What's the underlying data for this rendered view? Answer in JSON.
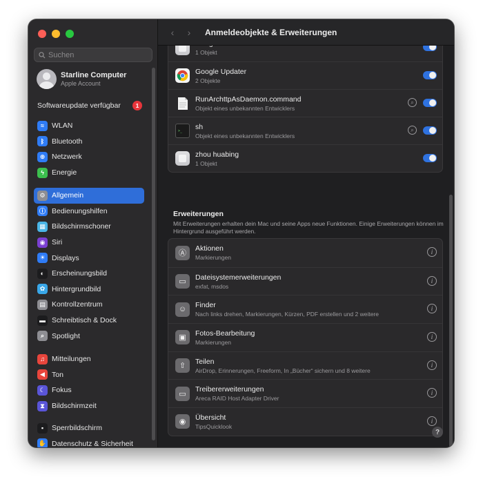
{
  "window": {
    "title": "Anmeldeobjekte & Erweiterungen",
    "back_icon": "‹",
    "forward_icon": "›"
  },
  "search": {
    "placeholder": "Suchen"
  },
  "account": {
    "name": "Starline Computer",
    "subtitle": "Apple Account"
  },
  "update": {
    "label": "Softwareupdate verfügbar",
    "count": "1"
  },
  "sidebar": {
    "group1": [
      {
        "label": "WLAN",
        "icon": "wifi-icon",
        "color": "#2f7cf6",
        "glyph": "≈"
      },
      {
        "label": "Bluetooth",
        "icon": "bluetooth-icon",
        "color": "#2f7cf6",
        "glyph": "ᛒ"
      },
      {
        "label": "Netzwerk",
        "icon": "globe-icon",
        "color": "#2f7cf6",
        "glyph": "⊕"
      },
      {
        "label": "Energie",
        "icon": "battery-icon",
        "color": "#3cbf4e",
        "glyph": "ϟ"
      }
    ],
    "group2": [
      {
        "label": "Allgemein",
        "icon": "gear-icon",
        "color": "#8e8e93",
        "glyph": "⚙",
        "selected": true
      },
      {
        "label": "Bedienungshilfen",
        "icon": "accessibility-icon",
        "color": "#2f7cf6",
        "glyph": "ⓘ"
      },
      {
        "label": "Bildschirmschoner",
        "icon": "screensaver-icon",
        "color": "#4ab5e6",
        "glyph": "▦"
      },
      {
        "label": "Siri",
        "icon": "siri-icon",
        "color": "#7a3fd1",
        "glyph": "◉"
      },
      {
        "label": "Displays",
        "icon": "display-icon",
        "color": "#2f7cf6",
        "glyph": "☀"
      },
      {
        "label": "Erscheinungsbild",
        "icon": "appearance-icon",
        "color": "#1c1c1e",
        "glyph": "◐"
      },
      {
        "label": "Hintergrundbild",
        "icon": "wallpaper-icon",
        "color": "#39a7e8",
        "glyph": "✿"
      },
      {
        "label": "Kontrollzentrum",
        "icon": "control-center-icon",
        "color": "#8e8e93",
        "glyph": "▤"
      },
      {
        "label": "Schreibtisch & Dock",
        "icon": "dock-icon",
        "color": "#1c1c1e",
        "glyph": "▬"
      },
      {
        "label": "Spotlight",
        "icon": "spotlight-icon",
        "color": "#8e8e93",
        "glyph": "⌕"
      }
    ],
    "group3": [
      {
        "label": "Mitteilungen",
        "icon": "bell-icon",
        "color": "#e8453c",
        "glyph": "♫"
      },
      {
        "label": "Ton",
        "icon": "sound-icon",
        "color": "#e8453c",
        "glyph": "◀"
      },
      {
        "label": "Fokus",
        "icon": "moon-icon",
        "color": "#5a55d8",
        "glyph": "☾"
      },
      {
        "label": "Bildschirmzeit",
        "icon": "hourglass-icon",
        "color": "#5a55d8",
        "glyph": "⧗"
      }
    ],
    "group4": [
      {
        "label": "Sperrbildschirm",
        "icon": "lock-screen-icon",
        "color": "#1c1c1e",
        "glyph": "▪"
      },
      {
        "label": "Datenschutz & Sicherheit",
        "icon": "hand-icon",
        "color": "#2f7cf6",
        "glyph": "✋"
      }
    ]
  },
  "login_items": [
    {
      "title": "Google LLC",
      "subtitle": "1 Objekt",
      "icon": "generic-app-icon",
      "toggle": true,
      "magnifier": false
    },
    {
      "title": "Google Updater",
      "subtitle": "2 Objekte",
      "icon": "chrome-icon",
      "toggle": true,
      "magnifier": false
    },
    {
      "title": "RunArchttpAsDaemon.command",
      "subtitle": "Objekt eines unbekannten Entwicklers",
      "icon": "document-icon",
      "toggle": true,
      "magnifier": true
    },
    {
      "title": "sh",
      "subtitle": "Objekt eines unbekannten Entwicklers",
      "icon": "terminal-icon",
      "toggle": true,
      "magnifier": true
    },
    {
      "title": "zhou huabing",
      "subtitle": "1 Objekt",
      "icon": "generic-app-icon",
      "toggle": true,
      "magnifier": false
    }
  ],
  "extensions": {
    "title": "Erweiterungen",
    "description": "Mit Erweiterungen erhalten dein Mac und seine Apps neue Funktionen. Einige Erweiterungen können im Hintergrund ausgeführt werden.",
    "items": [
      {
        "title": "Aktionen",
        "subtitle": "Markierungen",
        "icon": "actions-icon",
        "glyph": "Ⓐ"
      },
      {
        "title": "Dateisystemerweiterungen",
        "subtitle": "exfat, msdos",
        "icon": "extension-icon",
        "glyph": "▭"
      },
      {
        "title": "Finder",
        "subtitle": "Nach links drehen, Markierungen, Kürzen, PDF erstellen und 2 weitere",
        "icon": "finder-icon",
        "glyph": "☺"
      },
      {
        "title": "Fotos-Bearbeitung",
        "subtitle": "Markierungen",
        "icon": "photos-edit-icon",
        "glyph": "▣"
      },
      {
        "title": "Teilen",
        "subtitle": "AirDrop, Erinnerungen, Freeform, In „Bücher“ sichern und 8 weitere",
        "icon": "share-icon",
        "glyph": "⇧"
      },
      {
        "title": "Treibererweiterungen",
        "subtitle": "Areca RAID Host Adapter Driver",
        "icon": "driver-icon",
        "glyph": "▭"
      },
      {
        "title": "Übersicht",
        "subtitle": "TipsQuicklook",
        "icon": "eye-icon",
        "glyph": "◉"
      }
    ]
  },
  "help": {
    "label": "?"
  }
}
